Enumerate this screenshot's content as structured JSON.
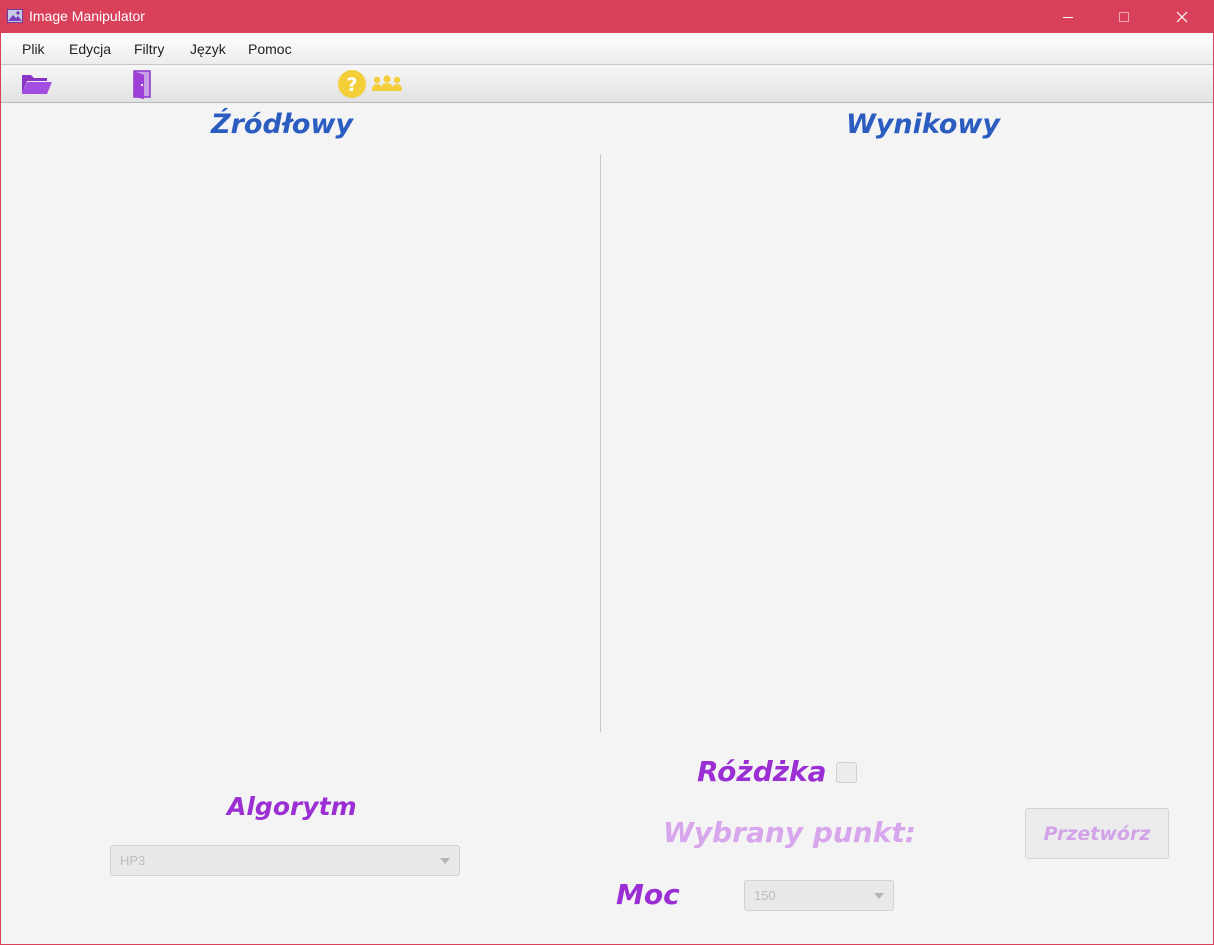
{
  "window": {
    "title": "Image Manipulator",
    "accent_color": "#d9405a"
  },
  "menu": {
    "items": [
      "Plik",
      "Edycja",
      "Filtry",
      "Język",
      "Pomoc"
    ]
  },
  "toolbar": {
    "icons": [
      "open-folder-icon",
      "exit-door-icon",
      "help-icon",
      "authors-icon"
    ]
  },
  "panels": {
    "source_title": "Źródłowy",
    "result_title": "Wynikowy",
    "title_color": "#2b5cc0"
  },
  "controls": {
    "algorithm_label": "Algorytm",
    "algorithm_value": "HP3",
    "wand_label": "Różdżka",
    "wand_checked": false,
    "selected_point_label": "Wybrany punkt:",
    "power_label": "Moc",
    "power_value": "150",
    "process_button": "Przetwórz",
    "label_color": "#9b2fd3"
  }
}
